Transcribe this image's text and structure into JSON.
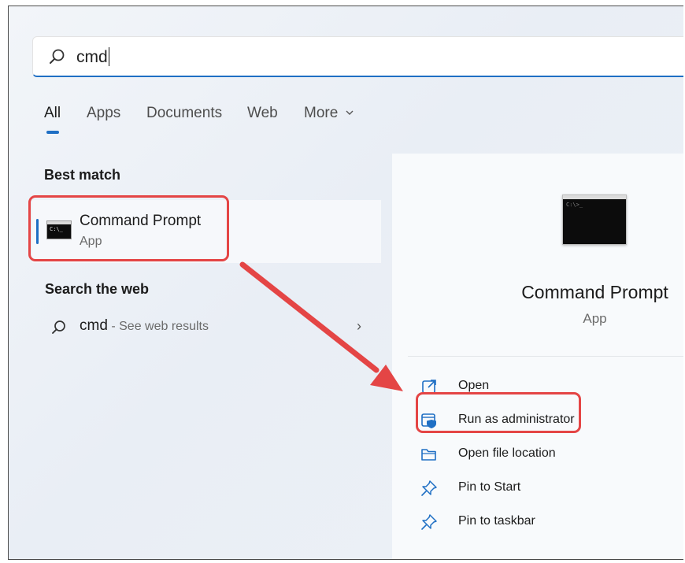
{
  "search": {
    "query": "cmd"
  },
  "tabs": [
    {
      "label": "All",
      "active": true
    },
    {
      "label": "Apps",
      "active": false
    },
    {
      "label": "Documents",
      "active": false
    },
    {
      "label": "Web",
      "active": false
    },
    {
      "label": "More",
      "active": false,
      "icon": "chevron-down-icon"
    }
  ],
  "best_match": {
    "heading": "Best match",
    "title": "Command Prompt",
    "subtitle": "App",
    "icon": "command-prompt-icon"
  },
  "web": {
    "heading": "Search the web",
    "query": "cmd",
    "suffix": " - See web results",
    "icon": "search-icon"
  },
  "detail": {
    "title": "Command Prompt",
    "subtitle": "App",
    "actions": [
      {
        "label": "Open",
        "icon": "open-external-icon"
      },
      {
        "label": "Run as administrator",
        "icon": "shield-admin-icon"
      },
      {
        "label": "Open file location",
        "icon": "folder-icon"
      },
      {
        "label": "Pin to Start",
        "icon": "pin-icon"
      },
      {
        "label": "Pin to taskbar",
        "icon": "pin-icon"
      }
    ]
  },
  "colors": {
    "accent": "#1f6fc4",
    "highlight": "#e44545",
    "console": "#0c0c0c"
  }
}
